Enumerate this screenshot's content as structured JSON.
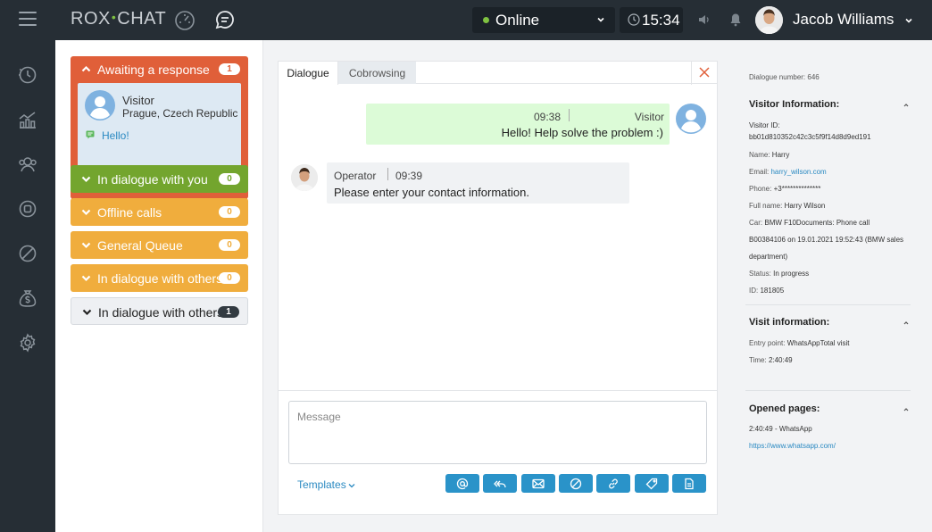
{
  "topbar": {
    "logo_left": "ROX",
    "logo_dot": "•",
    "logo_right": "CHAT",
    "status": "Online",
    "clock": "15:34",
    "user_name": "Jacob Williams"
  },
  "queues": {
    "awaiting": {
      "title": "Awaiting a response",
      "count": "1",
      "color": "#e05f39"
    },
    "visitor_card": {
      "name": "Visitor",
      "location": "Prague, Czech Republic",
      "message": "Hello!"
    },
    "items": [
      {
        "title": "In dialogue with you",
        "count": "0",
        "color": "#73a52e"
      },
      {
        "title": "Offline calls",
        "count": "0",
        "color": "#f0ad3d"
      },
      {
        "title": "General Queue",
        "count": "0",
        "color": "#f0ad3d"
      },
      {
        "title": "In dialogue with others",
        "count": "0",
        "color": "#f0ad3d"
      },
      {
        "title": "In dialogue with others",
        "count": "1",
        "color": "#eef0f3"
      }
    ]
  },
  "dialogue": {
    "tabs": [
      "Dialogue",
      "Cobrowsing"
    ],
    "visitor_message": {
      "time": "09:38",
      "sender": "Visitor",
      "text": "Hello! Help solve the problem :)"
    },
    "operator_message": {
      "sender": "Operator",
      "time": "09:39",
      "text": "Please enter your contact information."
    },
    "message_placeholder": "Message",
    "templates_label": "Templates",
    "tools": [
      "at-icon",
      "reply-all-icon",
      "mail-icon",
      "block-icon",
      "link-icon",
      "tag-icon",
      "document-icon"
    ]
  },
  "info": {
    "dialogue_number": "Dialogue number: 646",
    "visitor_info_title": "Visitor Information:",
    "visitor_id_label": "Visitor ID:",
    "visitor_id": "bb01d810352c42c3c5f9f14d8d9ed191",
    "name_label": "Name:",
    "name": "Harry",
    "email_label": "Email:",
    "email": "harry_wilson.com",
    "phone_label": "Phone:",
    "phone": "+3**************",
    "fullname_label": "Full name:",
    "fullname": "Harry Wilson",
    "car_label": "Car:",
    "car_line1": "BMW F10Documents: Phone call",
    "car_line2": "B00384106 on 19.01.2021 19:52:43 (BMW sales",
    "car_line3": "department)",
    "status_label": "Status:",
    "status": "In progress",
    "id_label": "ID:",
    "id": "181805",
    "visit_info_title": "Visit information:",
    "entry_label": "Entry point:",
    "entry": "WhatsAppTotal visit",
    "time_label": "Time:",
    "time": "2:40:49",
    "opened_pages_title": "Opened pages:",
    "page_time": "2:40:49",
    "page_dash": "-",
    "page_name": "WhatsApp",
    "page_url": "https://www.whatsapp.com/"
  }
}
